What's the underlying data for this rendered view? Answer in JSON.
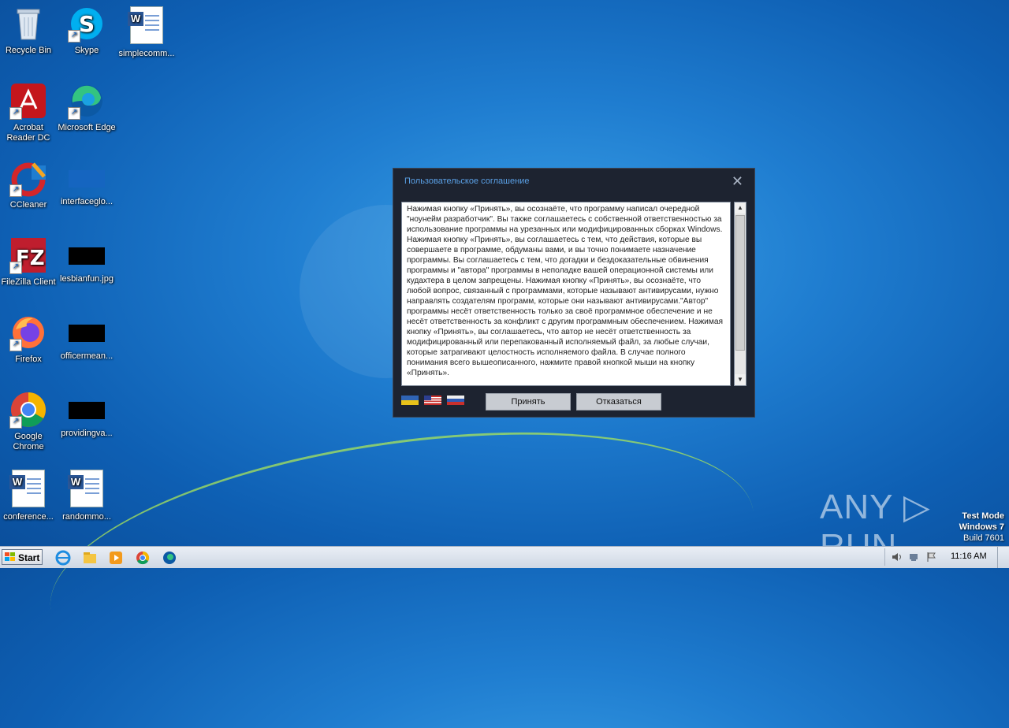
{
  "desktop": {
    "icons": [
      {
        "label": "Recycle Bin"
      },
      {
        "label": "Skype"
      },
      {
        "label": "simplecomm..."
      },
      {
        "label": "Acrobat Reader DC"
      },
      {
        "label": "Microsoft Edge"
      },
      {
        "label": "CCleaner"
      },
      {
        "label": "interfaceglo..."
      },
      {
        "label": "FileZilla Client"
      },
      {
        "label": "lesbianfun.jpg"
      },
      {
        "label": "Firefox"
      },
      {
        "label": "officermean..."
      },
      {
        "label": "Google Chrome"
      },
      {
        "label": "providingva..."
      },
      {
        "label": "conference..."
      },
      {
        "label": "randommo..."
      }
    ]
  },
  "dialog": {
    "title": "Пользовательское соглашение",
    "close_label": "✕",
    "agreement_text": "Нажимая кнопку «Принять», вы осознаёте, что программу написал очередной \"ноунейм разработчик\". Вы также соглашаетесь с собственной ответственностью за использование программы на урезанных или модифицированных сборках Windows. Нажимая кнопку «Принять», вы соглашаетесь с тем, что действия, которые вы совершаете в программе, обдуманы вами, и вы точно понимаете назначение программы. Вы соглашаетесь с тем, что догадки и бездоказательные обвинения программы и \"автора\" программы в неполадке вашей операционной системы или кудахтера в целом запрещены. Нажимая кнопку «Принять», вы осознаёте, что любой вопрос, связанный с программами, которые называют антивирусами, нужно направлять создателям программ, которые они называют антивирусами.\"Автор\" программы несёт ответственность только за своё программное обеспечение и не несёт ответственность за конфликт с другим программным обеспечением. Нажимая кнопку «Принять», вы соглашаетесь, что автор не несёт ответственность за модифицированный или перепакованный исполняемый файл, за любые случаи, которые затрагивают целостность исполняемого файла. В случае полного понимания всего вышеописанного, нажмите правой кнопкой мыши на кнопку «Принять».",
    "accept_label": "Принять",
    "decline_label": "Отказаться",
    "flags": [
      "ukraine-flag",
      "usa-flag",
      "russia-flag"
    ]
  },
  "watermark": {
    "text": "ANY ▷ RUN"
  },
  "test_mode": {
    "line1": "Test Mode",
    "line2": "Windows 7",
    "line3": "Build 7601"
  },
  "taskbar": {
    "start_label": "Start",
    "clock": "11:16 AM",
    "pinned": [
      "internet-explorer-icon",
      "explorer-icon",
      "media-player-icon",
      "chrome-icon",
      "edge-icon"
    ]
  },
  "colors": {
    "dialog_bg": "#1d2330",
    "title_accent": "#5aa0e6"
  }
}
